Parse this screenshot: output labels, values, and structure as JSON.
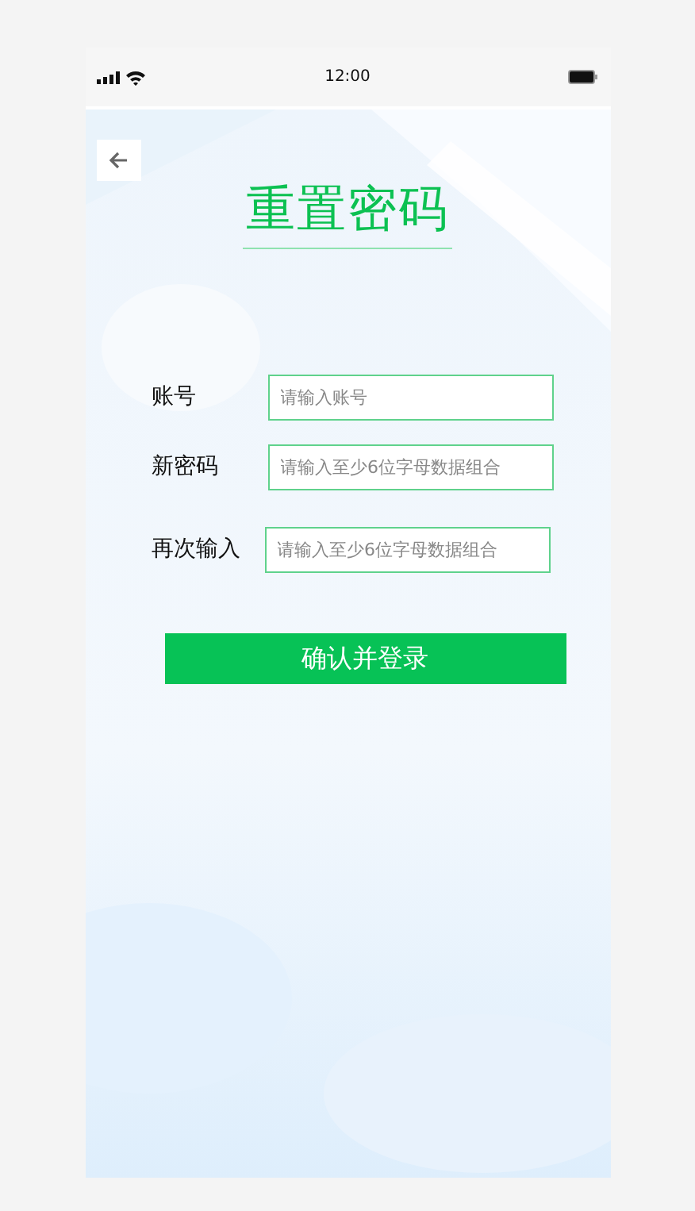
{
  "status_bar": {
    "time": "12:00"
  },
  "title": "重置密码",
  "fields": [
    {
      "label": "账号",
      "placeholder": "请输入账号"
    },
    {
      "label": "新密码",
      "placeholder": "请输入至少6位字母数据组合"
    },
    {
      "label": "再次输入",
      "placeholder": "请输入至少6位字母数据组合"
    }
  ],
  "submit_button": "确认并登录"
}
